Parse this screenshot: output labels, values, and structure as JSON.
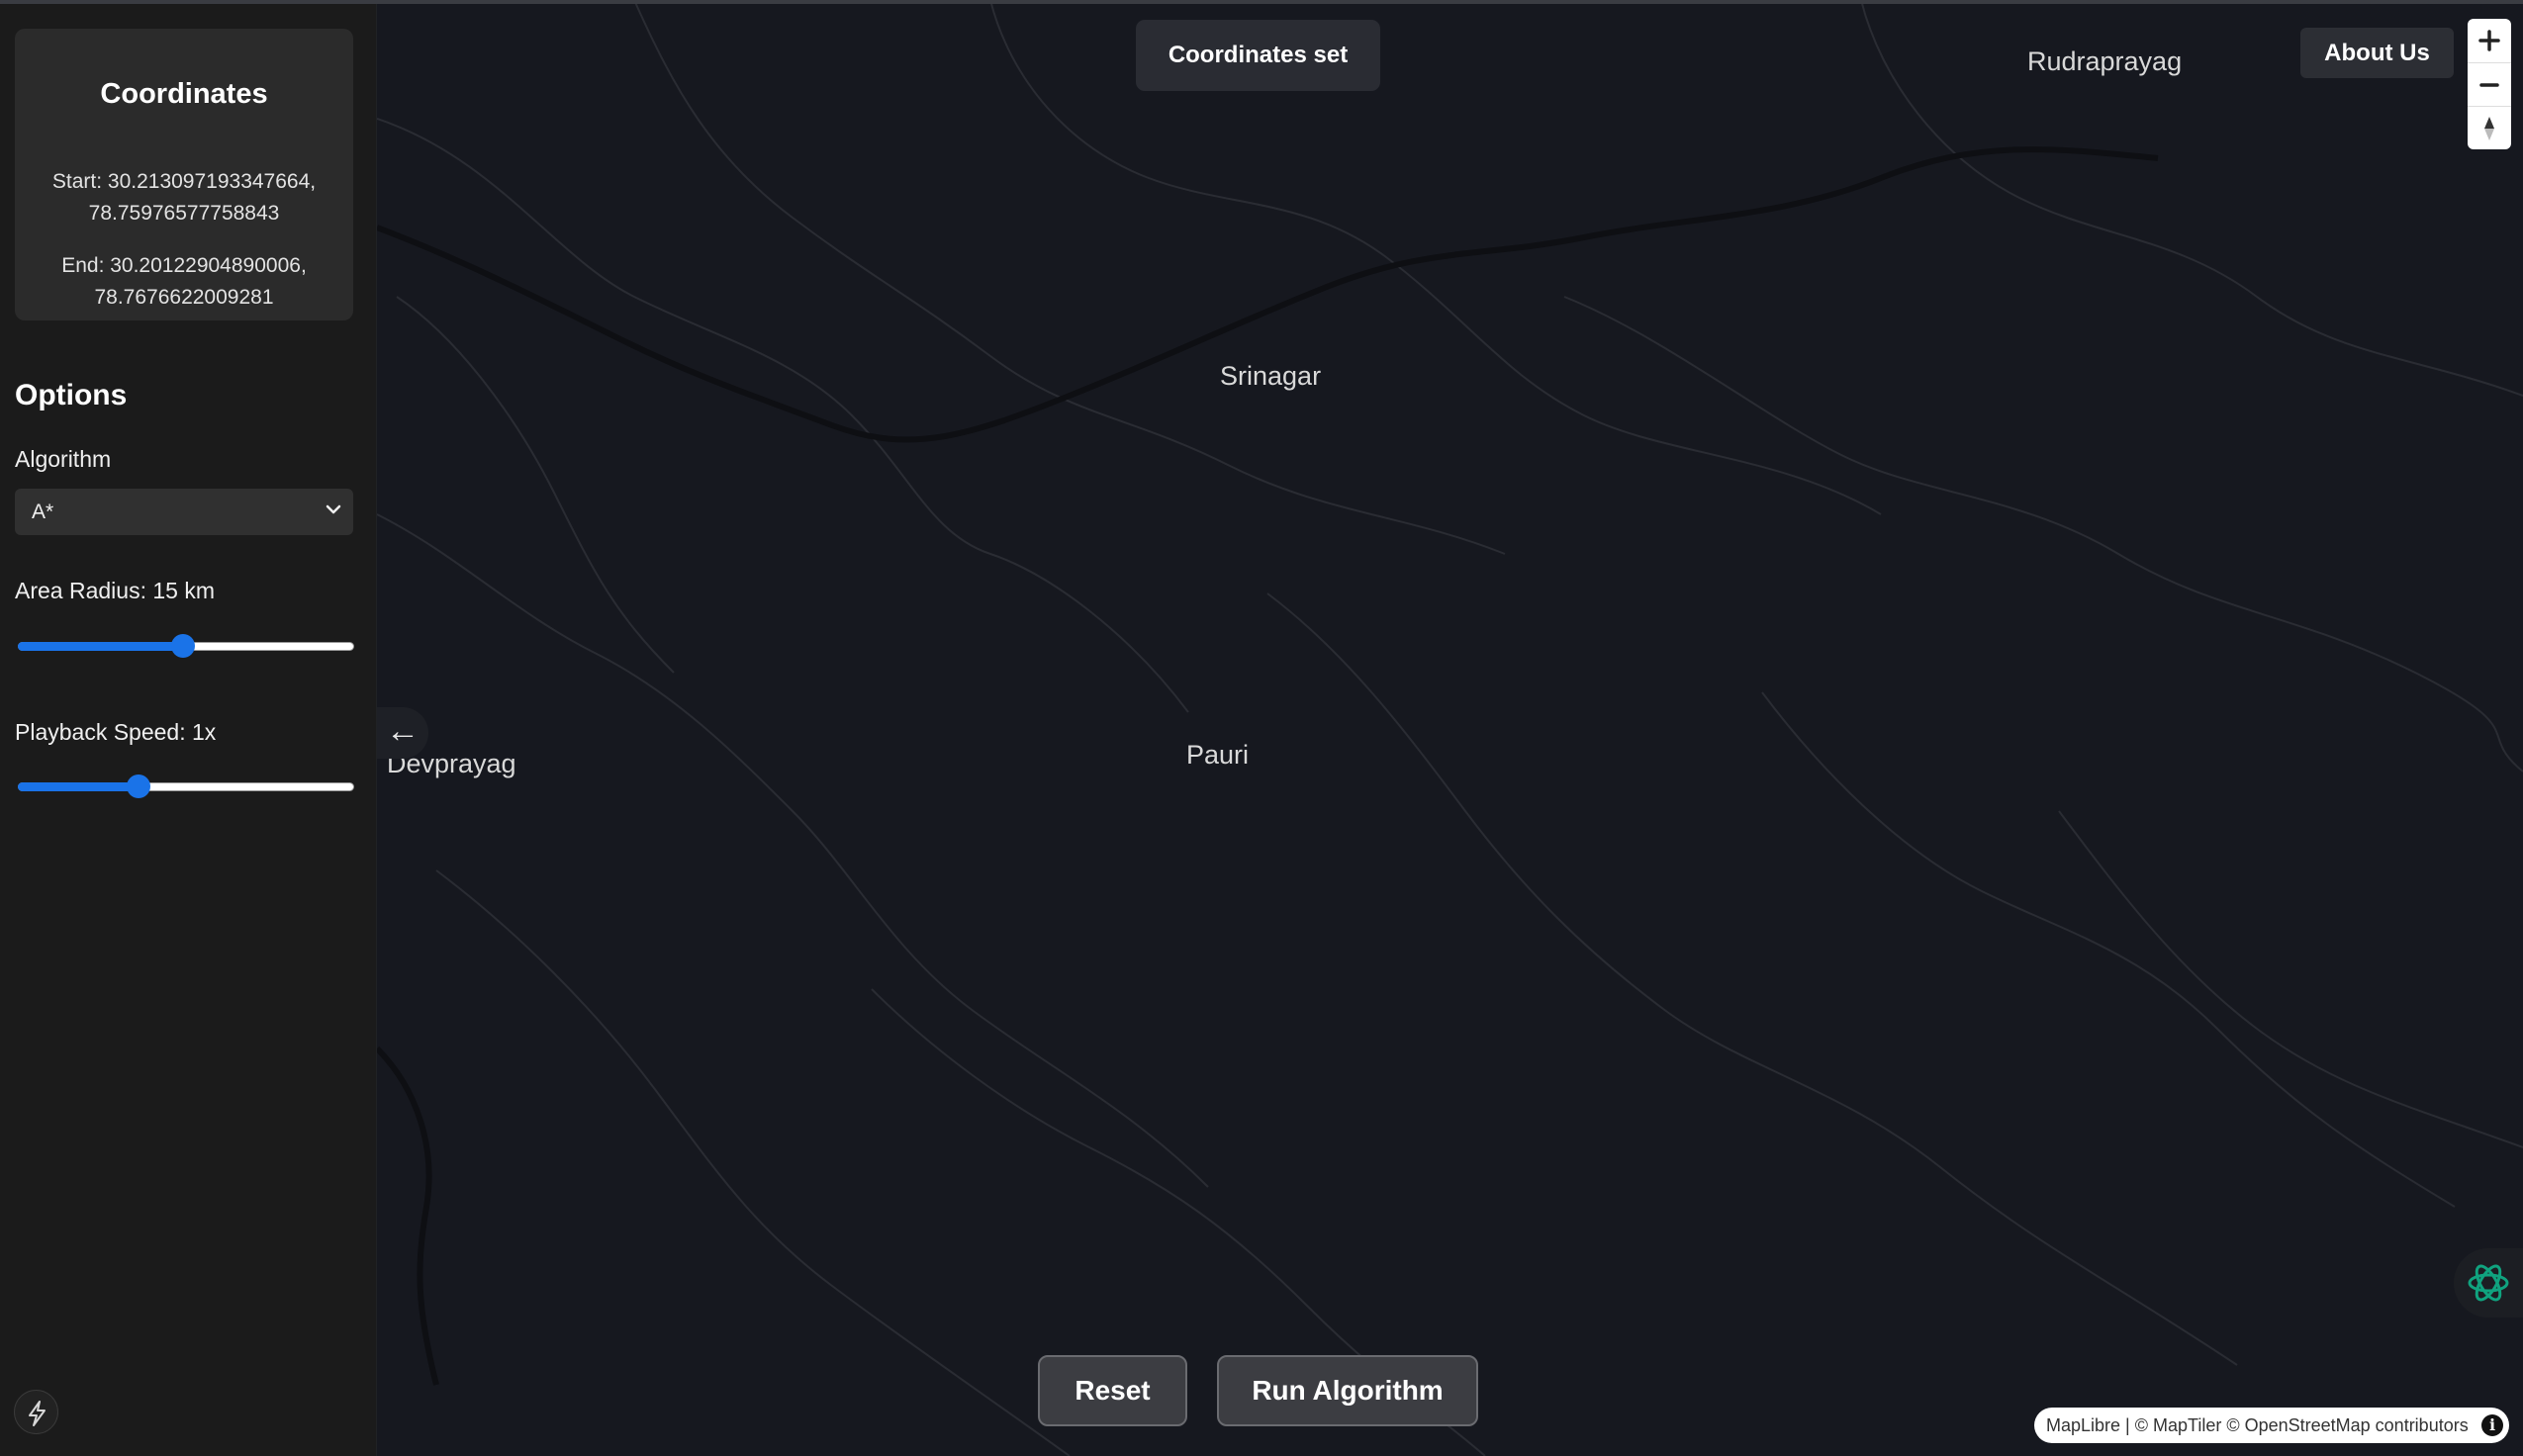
{
  "sidebar": {
    "coordinates": {
      "title": "Coordinates",
      "start_line1": "Start: 30.213097193347664,",
      "start_line2": "78.75976577758843",
      "end_line1": "End: 30.20122904890006,",
      "end_line2": "78.7676622009281"
    },
    "options": {
      "title": "Options",
      "algorithm_label": "Algorithm",
      "algorithm_value": "A*",
      "radius_label": "Area Radius: 15 km",
      "radius_fraction": 0.49,
      "speed_label": "Playback Speed: 1x",
      "speed_fraction": 0.36
    },
    "bolt_icon": "lightning-bolt-icon"
  },
  "map": {
    "places": {
      "rudraprayag": "Rudraprayag",
      "srinagar": "Srinagar",
      "pauri": "Pauri",
      "devprayag": "Devprayag"
    },
    "collapse_arrow": "←",
    "toast": "Coordinates set",
    "about_button": "About Us",
    "reset_button": "Reset",
    "run_button": "Run Algorithm",
    "attribution": "MapLibre | © MapTiler © OpenStreetMap contributors",
    "info_glyph": "i"
  },
  "colors": {
    "accent": "#1a73e8",
    "map_background": "#16181f",
    "sidebar_background": "#1b1b1b",
    "ai_icon": "#10a37f"
  }
}
